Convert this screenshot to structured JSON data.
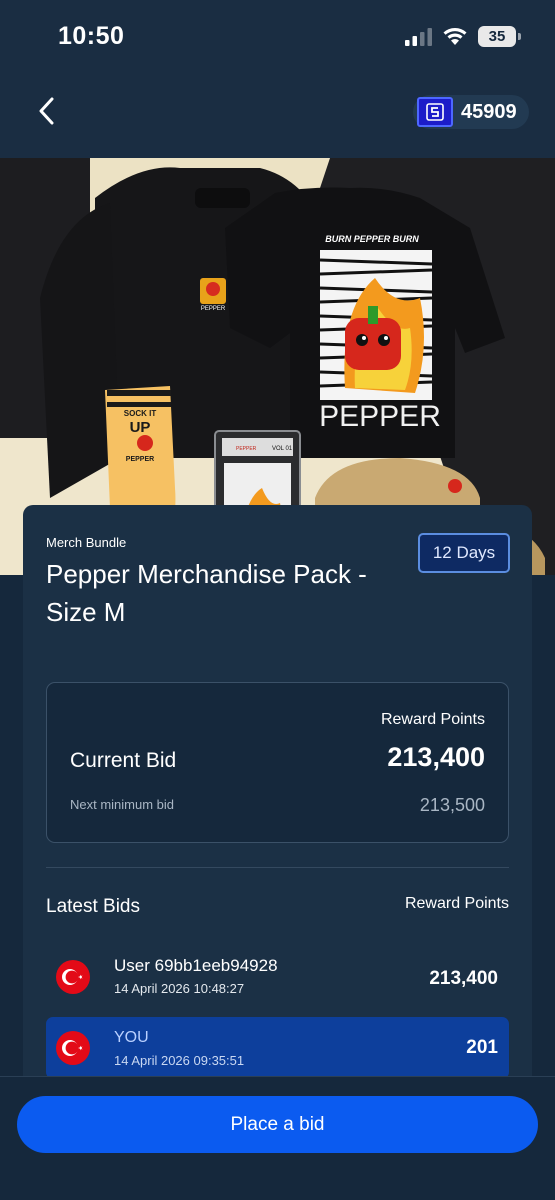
{
  "status_bar": {
    "time": "10:50",
    "battery": "35",
    "icons": [
      "signal-icon",
      "wifi-icon",
      "battery-icon"
    ]
  },
  "header": {
    "back_icon": "chevron-left-icon",
    "points_icon": "points-logo-icon",
    "points_balance": "45909"
  },
  "hero": {
    "tshirt_banner": "BURN PEPPER BURN",
    "tshirt_text": "PEPPER",
    "sock_text_1": "SOCK IT",
    "sock_text_2": "UP",
    "sock_brand": "PEPPER",
    "hoodie_patch": "PEPPER",
    "card_label": "VOL 01",
    "card_brand": "PEPPER"
  },
  "product": {
    "category": "Merch Bundle",
    "title": "Pepper Merchandise Pack - Size M",
    "time_left": "12 Days"
  },
  "bid_summary": {
    "reward_points_label": "Reward Points",
    "current_bid_label": "Current Bid",
    "current_bid_value": "213,400",
    "next_min_label": "Next minimum bid",
    "next_min_value": "213,500"
  },
  "latest_bids": {
    "title": "Latest Bids",
    "reward_points_label": "Reward Points",
    "rows": [
      {
        "user": "User 69bb1eeb94928",
        "time": "14 April 2026 10:48:27",
        "amount": "213,400",
        "flag": "turkey-flag-icon"
      },
      {
        "user": "YOU",
        "time": "14 April 2026 09:35:51",
        "amount": "201",
        "flag": "turkey-flag-icon"
      }
    ]
  },
  "actions": {
    "place_bid_label": "Place a bid"
  },
  "colors": {
    "background": "#15283c",
    "card": "#1b3045",
    "accent": "#0b5bf0",
    "highlight_row": "#0d3f9c",
    "days_badge": "#0e2a63"
  }
}
